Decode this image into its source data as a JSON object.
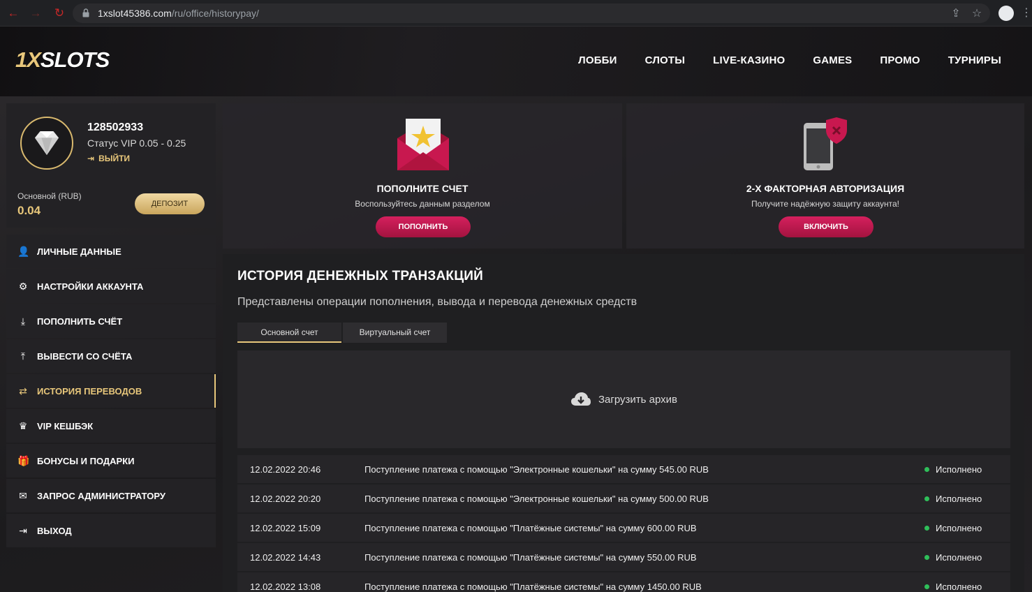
{
  "browser": {
    "url_host": "1xslot45386.com",
    "url_path": "/ru/office/historypay/"
  },
  "brand": {
    "logo_prefix": "1X",
    "logo_rest": "SLOTS",
    "accent": "#e8c77b",
    "primary_button": "#c8184f",
    "status_ok": "#2fbf5a"
  },
  "nav": {
    "items": [
      {
        "label": "ЛОББИ"
      },
      {
        "label": "СЛОТЫ"
      },
      {
        "label": "LIVE-КАЗИНО"
      },
      {
        "label": "GAMES"
      },
      {
        "label": "ПРОМО"
      },
      {
        "label": "ТУРНИРЫ"
      }
    ]
  },
  "profile": {
    "user_id": "128502933",
    "status": "Статус VIP 0.05 - 0.25",
    "logout_label": "ВЫЙТИ",
    "account_label": "Основной (RUB)",
    "balance": "0.04",
    "deposit_label": "ДЕПОЗИТ"
  },
  "sidebar": {
    "items": [
      {
        "label": "ЛИЧНЫЕ ДАННЫЕ",
        "icon": "user-plus-icon",
        "glyph": "👤"
      },
      {
        "label": "НАСТРОЙКИ АККАУНТА",
        "icon": "gears-icon",
        "glyph": "⚙"
      },
      {
        "label": "ПОПОЛНИТЬ СЧЁТ",
        "icon": "download-icon",
        "glyph": "⤓"
      },
      {
        "label": "ВЫВЕСТИ СО СЧЁТА",
        "icon": "upload-icon",
        "glyph": "⤒"
      },
      {
        "label": "ИСТОРИЯ ПЕРЕВОДОВ",
        "icon": "transfer-arrows-icon",
        "glyph": "⇄",
        "active": true
      },
      {
        "label": "VIP КЕШБЭК",
        "icon": "crown-icon",
        "glyph": "♛"
      },
      {
        "label": "БОНУСЫ И ПОДАРКИ",
        "icon": "gift-icon",
        "glyph": "🎁"
      },
      {
        "label": "ЗАПРОС АДМИНИСТРАТОРУ",
        "icon": "envelope-icon",
        "glyph": "✉"
      },
      {
        "label": "ВЫХОД",
        "icon": "sign-out-icon",
        "glyph": "⇥"
      }
    ]
  },
  "promo_cards": [
    {
      "title": "ПОПОЛНИТЕ СЧЕТ",
      "desc": "Воспользуйтесь данным разделом",
      "button": "ПОПОЛНИТЬ",
      "icon": "envelope-star-icon"
    },
    {
      "title": "2-Х ФАКТОРНАЯ АВТОРИЗАЦИЯ",
      "desc": "Получите надёжную защиту аккаунта!",
      "button": "ВКЛЮЧИТЬ",
      "icon": "phone-shield-icon"
    }
  ],
  "history": {
    "title": "ИСТОРИЯ ДЕНЕЖНЫХ ТРАНЗАКЦИЙ",
    "subtitle": "Представлены операции пополнения, вывода и перевода денежных средств",
    "tabs": [
      {
        "label": "Основной счет",
        "active": true
      },
      {
        "label": "Виртуальный счет",
        "active": false
      }
    ],
    "archive_label": "Загрузить архив",
    "rows": [
      {
        "date": "12.02.2022 20:46",
        "desc": "Поступление платежа с помощью \"Электронные кошельки\" на сумму 545.00 RUB",
        "status": "Исполнено"
      },
      {
        "date": "12.02.2022 20:20",
        "desc": "Поступление платежа с помощью \"Электронные кошельки\" на сумму 500.00 RUB",
        "status": "Исполнено"
      },
      {
        "date": "12.02.2022 15:09",
        "desc": "Поступление платежа с помощью \"Платёжные системы\" на сумму 600.00 RUB",
        "status": "Исполнено"
      },
      {
        "date": "12.02.2022 14:43",
        "desc": "Поступление платежа с помощью \"Платёжные системы\" на сумму 550.00 RUB",
        "status": "Исполнено"
      },
      {
        "date": "12.02.2022 13:08",
        "desc": "Поступление платежа с помощью \"Платёжные системы\" на сумму 1450.00 RUB",
        "status": "Исполнено"
      }
    ]
  }
}
